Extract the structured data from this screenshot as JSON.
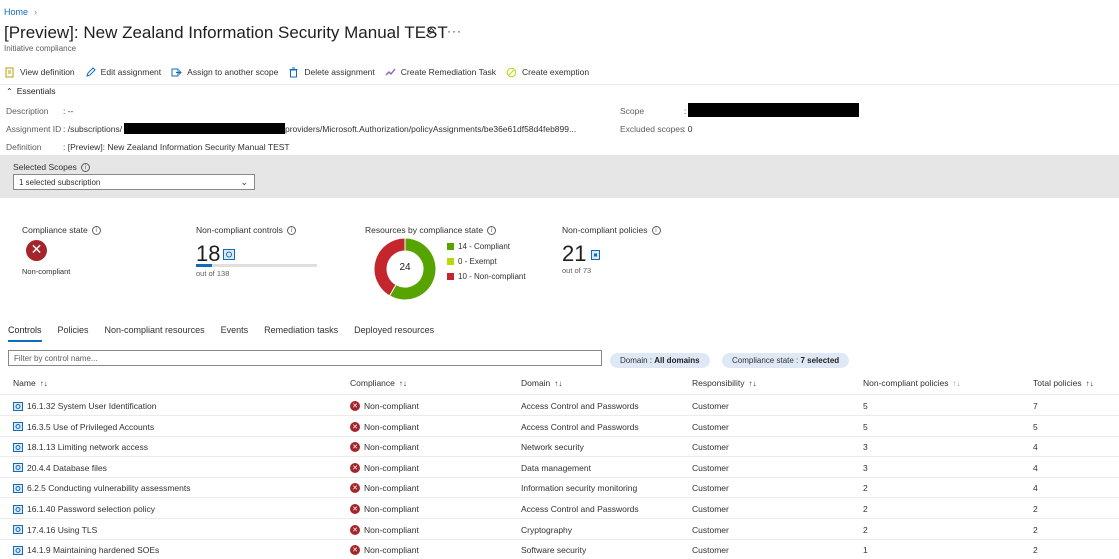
{
  "breadcrumb": {
    "home": "Home"
  },
  "header": {
    "title": "[Preview]: New Zealand Information Security Manual TEST",
    "subtitle": "Initiative compliance"
  },
  "toolbar": {
    "view_definition": "View definition",
    "edit_assignment": "Edit assignment",
    "assign_scope": "Assign to another scope",
    "delete_assignment": "Delete assignment",
    "create_remediation": "Create Remediation Task",
    "create_exemption": "Create exemption"
  },
  "essentials": {
    "heading": "Essentials",
    "description_label": "Description",
    "description_value": ": --",
    "assignment_id_label": "Assignment ID",
    "assignment_id_prefix": ": /subscriptions/",
    "assignment_id_suffix": "providers/Microsoft.Authorization/policyAssignments/be36e61df58d4feb899...",
    "definition_label": "Definition",
    "definition_value": ": [Preview]: New Zealand Information Security Manual TEST",
    "scope_label": "Scope",
    "scope_sep": ":",
    "excluded_label": "Excluded scopes",
    "excluded_value": ": 0"
  },
  "scopes": {
    "label": "Selected Scopes",
    "selected": "1 selected subscription"
  },
  "metrics": {
    "compliance_state_label": "Compliance state",
    "compliance_state_value": "Non-compliant",
    "noncompliant_controls_label": "Non-compliant controls",
    "noncompliant_controls_value": "18",
    "noncompliant_controls_total": "out of 138",
    "noncompliant_controls_fraction": 0.13,
    "resources_label": "Resources by compliance state",
    "resources_total": "24",
    "resources_legend": [
      {
        "label": "14 - Compliant",
        "color": "#57a300",
        "value": 14
      },
      {
        "label": "0 - Exempt",
        "color": "#bad80a",
        "value": 0
      },
      {
        "label": "10 - Non-compliant",
        "color": "#c4262e",
        "value": 10
      }
    ],
    "noncompliant_policies_label": "Non-compliant policies",
    "noncompliant_policies_value": "21",
    "noncompliant_policies_total": "out of 73"
  },
  "tabs": [
    "Controls",
    "Policies",
    "Non-compliant resources",
    "Events",
    "Remediation tasks",
    "Deployed resources"
  ],
  "filter": {
    "placeholder": "Filter by control name..."
  },
  "pills": {
    "domain_label": "Domain : ",
    "domain_value": "All domains",
    "state_label": "Compliance state : ",
    "state_value": "7 selected"
  },
  "table": {
    "headers": [
      "Name",
      "Compliance",
      "Domain",
      "Responsibility",
      "Non-compliant policies",
      "Total policies"
    ],
    "rows": [
      {
        "name": "16.1.32 System User Identification",
        "compliance": "Non-compliant",
        "domain": "Access Control and Passwords",
        "responsibility": "Customer",
        "noncompliant": "5",
        "total": "7"
      },
      {
        "name": "16.3.5 Use of Privileged Accounts",
        "compliance": "Non-compliant",
        "domain": "Access Control and Passwords",
        "responsibility": "Customer",
        "noncompliant": "5",
        "total": "5"
      },
      {
        "name": "18.1.13 Limiting network access",
        "compliance": "Non-compliant",
        "domain": "Network security",
        "responsibility": "Customer",
        "noncompliant": "3",
        "total": "4"
      },
      {
        "name": "20.4.4 Database files",
        "compliance": "Non-compliant",
        "domain": "Data management",
        "responsibility": "Customer",
        "noncompliant": "3",
        "total": "4"
      },
      {
        "name": "6.2.5 Conducting vulnerability assessments",
        "compliance": "Non-compliant",
        "domain": "Information security monitoring",
        "responsibility": "Customer",
        "noncompliant": "2",
        "total": "4"
      },
      {
        "name": "16.1.40 Password selection policy",
        "compliance": "Non-compliant",
        "domain": "Access Control and Passwords",
        "responsibility": "Customer",
        "noncompliant": "2",
        "total": "2"
      },
      {
        "name": "17.4.16 Using TLS",
        "compliance": "Non-compliant",
        "domain": "Cryptography",
        "responsibility": "Customer",
        "noncompliant": "2",
        "total": "2"
      },
      {
        "name": "14.1.9 Maintaining hardened SOEs",
        "compliance": "Non-compliant",
        "domain": "Software security",
        "responsibility": "Customer",
        "noncompliant": "1",
        "total": "2"
      }
    ]
  },
  "icons": [
    "chevron-right-icon",
    "pin-icon",
    "more-icon",
    "document-icon",
    "pencil-icon",
    "assign-icon",
    "trash-icon",
    "remediation-icon",
    "exemption-icon",
    "chevron-up-icon",
    "info-icon",
    "chevron-down-icon",
    "error-icon",
    "control-icon",
    "policy-icon"
  ]
}
